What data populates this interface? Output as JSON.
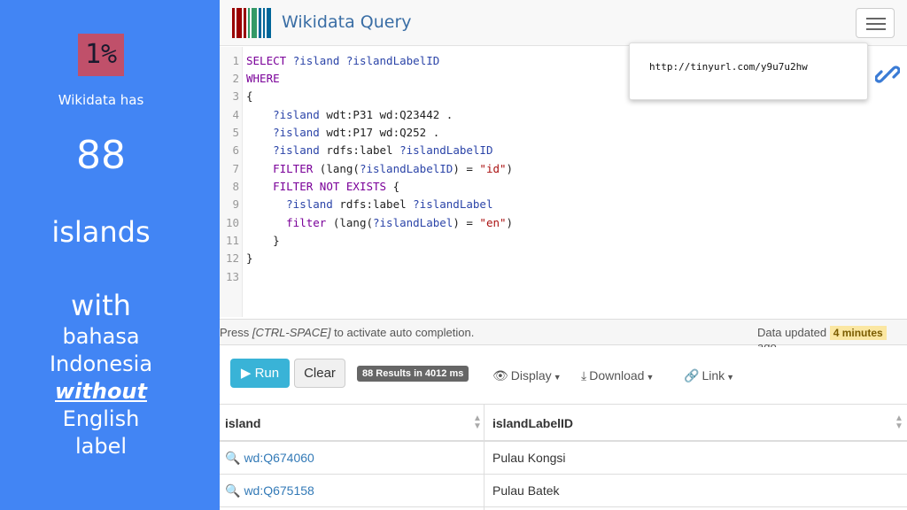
{
  "slide": {
    "percent": "1%",
    "has_text": "Wikidata has",
    "count": "88",
    "islands": "islands",
    "with": "with",
    "bahasa": "bahasa",
    "indonesia": "Indonesia",
    "without": "without",
    "english": "English",
    "label": "label"
  },
  "app": {
    "title": "Wikidata Query",
    "popup_url": "http://tinyurl.com/y9u7u2hw",
    "hint_prefix": "Press ",
    "hint_key": "[CTRL-SPACE]",
    "hint_suffix": " to activate auto completion.",
    "updated_prefix": "Data updated",
    "updated_value": "4 minutes",
    "updated_suffix": "ago"
  },
  "editor": {
    "line_numbers": [
      "1",
      "2",
      "3",
      "4",
      "5",
      "6",
      "7",
      "8",
      "9",
      "10",
      "11",
      "12",
      "13"
    ]
  },
  "toolbar": {
    "run_label": "Run",
    "clear_label": "Clear",
    "results_label": "88 Results in 4012 ms",
    "display_label": "Display",
    "download_label": "Download",
    "link_label": "Link"
  },
  "table": {
    "headers": [
      "island",
      "islandLabelID"
    ],
    "rows": [
      {
        "island": "wd:Q674060",
        "label": "Pulau Kongsi"
      },
      {
        "island": "wd:Q675158",
        "label": "Pulau Batek"
      }
    ]
  },
  "colors": {
    "panel": "#4285f4",
    "percent_box": "#c0506a",
    "run_button": "#39b3d7",
    "link": "#337ab7"
  }
}
